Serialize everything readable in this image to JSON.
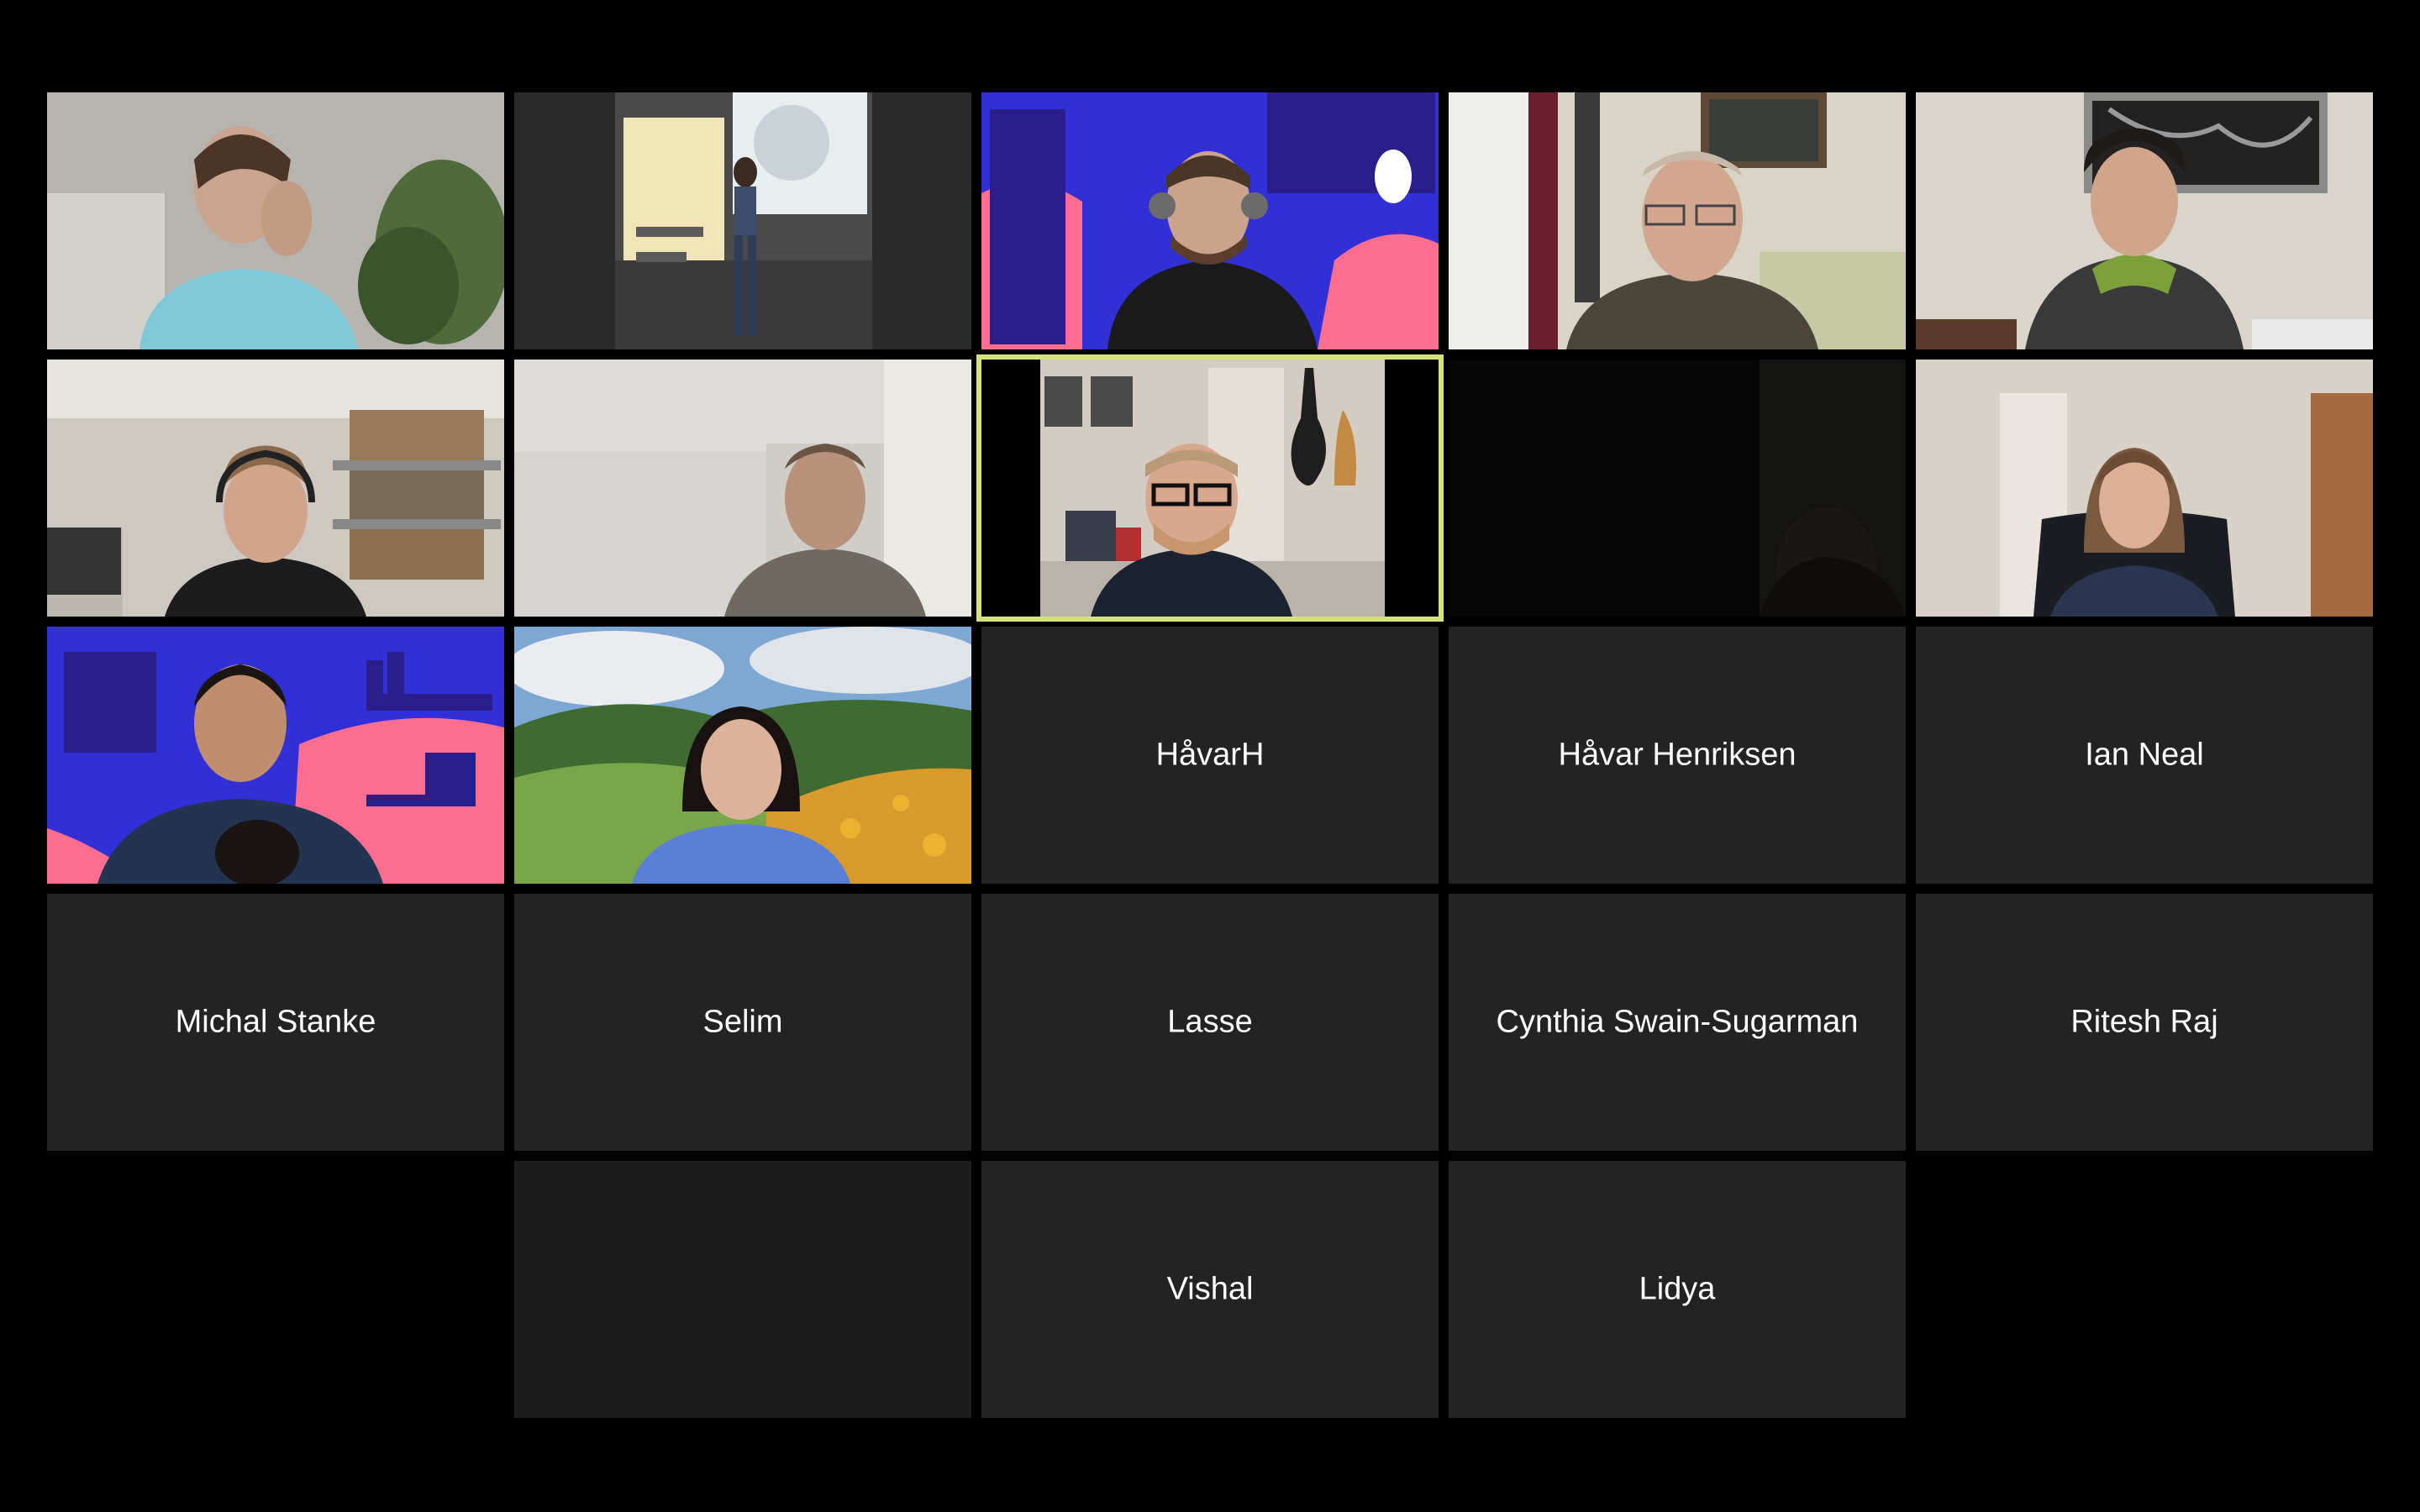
{
  "meeting": {
    "participants_with_video": [
      {
        "slot": "r1c1",
        "scene": "man-in-teal-shirt-with-plant"
      },
      {
        "slot": "r1c2",
        "scene": "speaker-on-stage-presentation"
      },
      {
        "slot": "r1c3",
        "scene": "man-headphones-purple-backdrop"
      },
      {
        "slot": "r1c4",
        "scene": "older-man-glasses-living-room"
      },
      {
        "slot": "r1c5",
        "scene": "man-green-hoodie-painting"
      },
      {
        "slot": "r2c1",
        "scene": "man-headset-bookshelf"
      },
      {
        "slot": "r2c2",
        "scene": "man-white-room"
      },
      {
        "slot": "r2c3",
        "scene": "man-glasses-guitar-room"
      },
      {
        "slot": "r2c4",
        "scene": "dark-camera"
      },
      {
        "slot": "r2c5",
        "scene": "woman-office-chair"
      },
      {
        "slot": "r3c1",
        "scene": "man-purple-backdrop"
      },
      {
        "slot": "r3c2",
        "scene": "woman-hills-flower-backdrop"
      }
    ],
    "participants_no_video": [
      {
        "slot": "r3c3",
        "name": "HåvarH"
      },
      {
        "slot": "r3c4",
        "name": "Håvar Henriksen"
      },
      {
        "slot": "r3c5",
        "name": "Ian Neal"
      },
      {
        "slot": "r4c1",
        "name": "Michal Stanke"
      },
      {
        "slot": "r4c2",
        "name": "Selim"
      },
      {
        "slot": "r4c3",
        "name": "Lasse"
      },
      {
        "slot": "r4c4",
        "name": "Cynthia Swain-Sugarman"
      },
      {
        "slot": "r4c5",
        "name": "Ritesh Raj"
      },
      {
        "slot": "r5c3",
        "name": "Vishal"
      },
      {
        "slot": "r5c4",
        "name": "Lidya"
      }
    ],
    "active_speaker_border_color": "#d6e37c",
    "tile_color": "#232323",
    "background_color": "#000000"
  }
}
